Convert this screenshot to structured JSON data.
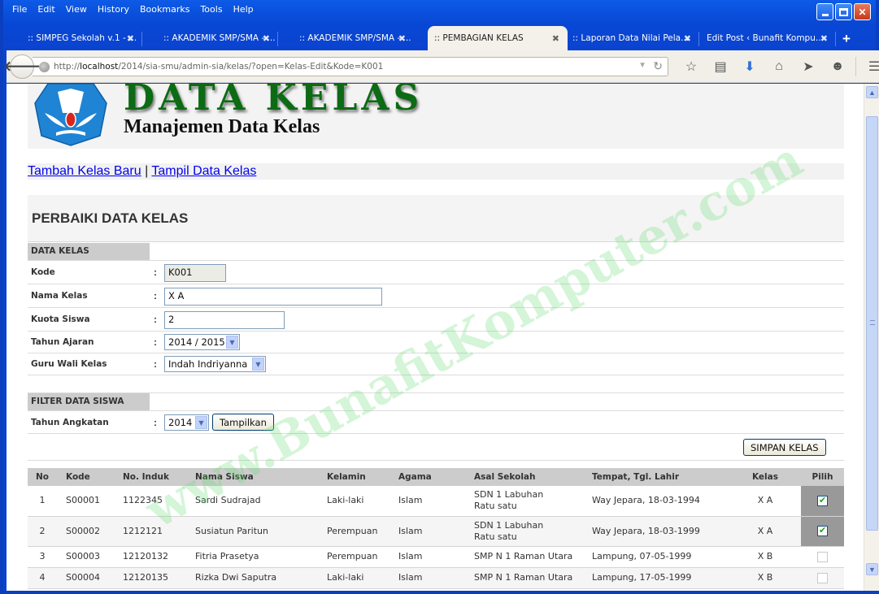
{
  "browser": {
    "menu": [
      {
        "label": "File",
        "accel": "F"
      },
      {
        "label": "Edit",
        "accel": "E"
      },
      {
        "label": "View",
        "accel": "V"
      },
      {
        "label": "History",
        "accel": "s"
      },
      {
        "label": "Bookmarks",
        "accel": "B"
      },
      {
        "label": "Tools",
        "accel": "T"
      },
      {
        "label": "Help",
        "accel": "H"
      }
    ],
    "tabs": [
      {
        "label": ":: SIMPEG Sekolah v.1 - ...",
        "active": false
      },
      {
        "label": ":: AKADEMIK SMP/SMA - ...",
        "active": false
      },
      {
        "label": ":: AKADEMIK SMP/SMA - ...",
        "active": false
      },
      {
        "label": ":: PEMBAGIAN KELAS",
        "active": true
      },
      {
        "label": ":: Laporan Data Nilai Pela...",
        "active": false
      },
      {
        "label": "Edit Post ‹ Bunafit Kompu...",
        "active": false
      }
    ],
    "new_tab_label": "+",
    "url": {
      "prefix": "http://",
      "host": "localhost",
      "path": "/2014/sia-smu/admin-sia/kelas/?open=Kelas-Edit&Kode=K001"
    },
    "toolbar_icons": [
      "bookmark-star-icon",
      "reading-list-icon",
      "download-icon",
      "home-icon",
      "send-icon",
      "chat-icon",
      "menu-icon"
    ]
  },
  "page": {
    "banner": {
      "title": "DATA KELAS",
      "subtitle": "Manajemen Data Kelas"
    },
    "links": {
      "add": "Tambah Kelas Baru",
      "separator": "|",
      "list": "Tampil Data Kelas"
    },
    "form_title": "PERBAIKI DATA KELAS",
    "section_data": "DATA KELAS",
    "fields": {
      "kode": {
        "label": "Kode",
        "value": "K001"
      },
      "nama_kelas": {
        "label": "Nama Kelas",
        "value": "X A"
      },
      "kuota_siswa": {
        "label": "Kuota Siswa",
        "value": "2"
      },
      "tahun_ajaran": {
        "label": "Tahun Ajaran",
        "value": "2014 / 2015"
      },
      "guru_wali": {
        "label": "Guru Wali Kelas",
        "value": "Indah Indriyanna"
      }
    },
    "colon": ":",
    "section_filter": "FILTER DATA SISWA",
    "filter": {
      "label": "Tahun Angkatan",
      "value": "2014",
      "button": "Tampilkan"
    },
    "save_button": "SIMPAN KELAS",
    "table": {
      "headers": [
        "No",
        "Kode",
        "No. Induk",
        "Nama Siswa",
        "Kelamin",
        "Agama",
        "Asal Sekolah",
        "Tempat, Tgl. Lahir",
        "Kelas",
        "Pilih"
      ],
      "rows": [
        {
          "no": "1",
          "kode": "S00001",
          "induk": "1122345",
          "nama": "Sardi Sudrajad",
          "kelamin": "Laki-laki",
          "agama": "Islam",
          "asal": "SDN 1 Labuhan Ratu satu",
          "ttl": "Way Jepara, 18-03-1994",
          "kelas": "X A",
          "checked": true
        },
        {
          "no": "2",
          "kode": "S00002",
          "induk": "1212121",
          "nama": "Susiatun Paritun",
          "kelamin": "Perempuan",
          "agama": "Islam",
          "asal": "SDN 1 Labuhan Ratu satu",
          "ttl": "Way Jepara, 18-03-1999",
          "kelas": "X A",
          "checked": true
        },
        {
          "no": "3",
          "kode": "S00003",
          "induk": "12120132",
          "nama": "Fitria Prasetya",
          "kelamin": "Perempuan",
          "agama": "Islam",
          "asal": "SMP N 1 Raman Utara",
          "ttl": "Lampung, 07-05-1999",
          "kelas": "X B",
          "checked": false
        },
        {
          "no": "4",
          "kode": "S00004",
          "induk": "12120135",
          "nama": "Rizka Dwi Saputra",
          "kelamin": "Laki-laki",
          "agama": "Islam",
          "asal": "SMP N 1 Raman Utara",
          "ttl": "Lampung, 17-05-1999",
          "kelas": "X B",
          "checked": false
        }
      ]
    },
    "watermark": "www.BunafitKomputer.com"
  }
}
